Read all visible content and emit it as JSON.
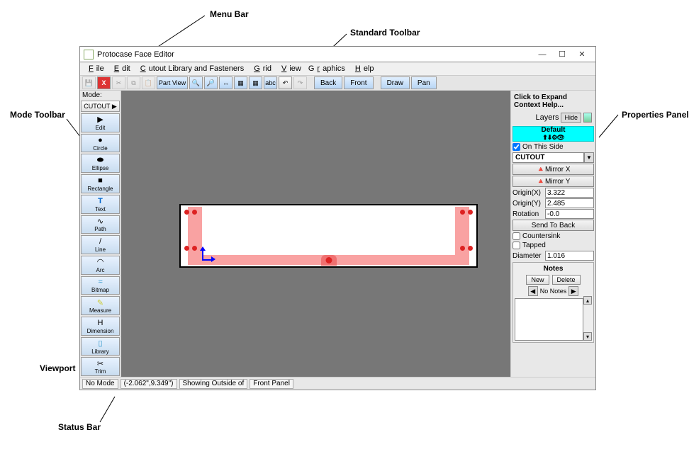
{
  "annotations": {
    "menuBar": "Menu Bar",
    "standardToolbar": "Standard Toolbar",
    "modeToolbar": "Mode Toolbar",
    "propertiesPanel": "Properties Panel",
    "viewport": "Viewport",
    "statusBar": "Status Bar"
  },
  "window": {
    "title": "Protocase Face Editor"
  },
  "menu": {
    "file": "File",
    "edit": "Edit",
    "cutout": "Cutout Library and Fasteners",
    "grid": "Grid",
    "view": "View",
    "graphics": "Graphics",
    "help": "Help"
  },
  "stdToolbar": {
    "partView": "Part\nView",
    "back": "Back",
    "front": "Front",
    "draw": "Draw",
    "pan": "Pan"
  },
  "modeBar": {
    "heading": "Mode:",
    "cutout": "CUTOUT ▶",
    "items": [
      {
        "label": "Edit",
        "icon": "▶"
      },
      {
        "label": "Circle",
        "icon": "●"
      },
      {
        "label": "Ellipse",
        "icon": "⬬"
      },
      {
        "label": "Rectangle",
        "icon": "■"
      },
      {
        "label": "Text",
        "icon": "T"
      },
      {
        "label": "Path",
        "icon": "∿"
      },
      {
        "label": "Line",
        "icon": "/"
      },
      {
        "label": "Arc",
        "icon": "◠"
      },
      {
        "label": "Bitmap",
        "icon": "≈"
      },
      {
        "label": "Measure",
        "icon": "✎"
      },
      {
        "label": "Dimension",
        "icon": "H"
      },
      {
        "label": "Library",
        "icon": "▯"
      },
      {
        "label": "Trim",
        "icon": "✂"
      }
    ]
  },
  "props": {
    "context": "Click to Expand Context Help...",
    "layersLabel": "Layers",
    "hide": "Hide",
    "default": "Default",
    "onThisSide": "On This Side",
    "cutout": "CUTOUT",
    "mirrorX": "Mirror X",
    "mirrorY": "Mirror Y",
    "originXLabel": "Origin(X)",
    "originYLabel": "Origin(Y)",
    "originX": "3.322",
    "originY": "2.485",
    "rotationLabel": "Rotation",
    "rotation": "-0.0",
    "sendToBack": "Send To Back",
    "countersink": "Countersink",
    "tapped": "Tapped",
    "diameterLabel": "Diameter",
    "diameter": "1.016",
    "notes": "Notes",
    "new": "New",
    "delete": "Delete",
    "noNotes": "No Notes"
  },
  "status": {
    "noMode": "No Mode",
    "coords": "(-2.062\",9.349\")",
    "showing": "Showing Outside of",
    "panel": "Front Panel"
  }
}
